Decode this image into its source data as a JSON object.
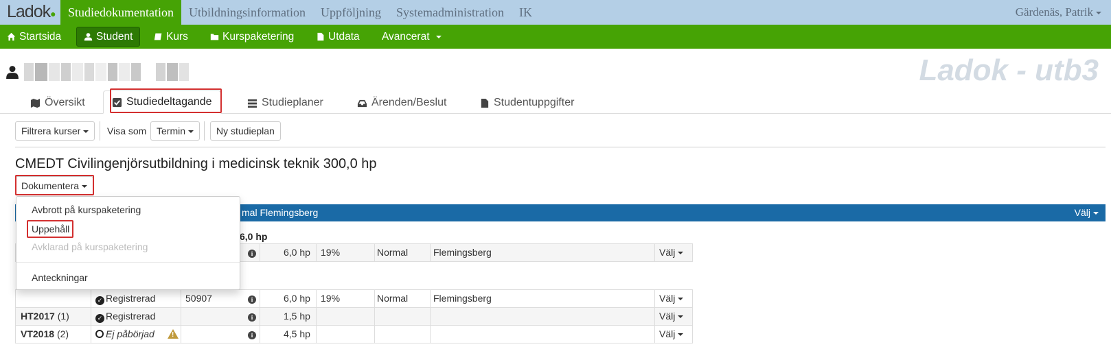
{
  "app": {
    "logo": "Ladok",
    "environment": "Ladok - utb3",
    "user": "Gärdenäs, Patrik"
  },
  "topnav": [
    {
      "label": "Studiedokumentation",
      "active": true
    },
    {
      "label": "Utbildningsinformation"
    },
    {
      "label": "Uppföljning"
    },
    {
      "label": "Systemadministration"
    },
    {
      "label": "IK"
    }
  ],
  "subnav": {
    "startsida": "Startsida",
    "student": "Student",
    "kurs": "Kurs",
    "kurspaketering": "Kurspaketering",
    "utdata": "Utdata",
    "avancerat": "Avancerat"
  },
  "tabs": {
    "oversikt": "Översikt",
    "studiedeltagande": "Studiedeltagande",
    "studieplaner": "Studieplaner",
    "arenden": "Ärenden/Beslut",
    "studentuppgifter": "Studentuppgifter"
  },
  "toolbar": {
    "filtrera": "Filtrera kurser",
    "visa_som": "Visa som",
    "termin": "Termin",
    "ny_studieplan": "Ny studieplan"
  },
  "program": {
    "title": "CMEDT Civilingenjörsutbildning i medicinsk teknik 300,0 hp",
    "dokumentera": "Dokumentera",
    "bluebar_text": "mal Flemingsberg",
    "bluebar_valj": "Välj",
    "partial_heading": "6,0 hp"
  },
  "dropdown": {
    "avbrott": "Avbrott på kurspaketering",
    "uppehall": "Uppehåll",
    "avklarad": "Avklarad på kurspaketering",
    "anteckningar": "Anteckningar"
  },
  "rows": [
    {
      "period": "",
      "count": "",
      "status": "",
      "code": "",
      "hp": "6,0 hp",
      "pct": "19%",
      "tempo": "Normal",
      "ort": "Flemingsberg",
      "valj": "Välj"
    },
    {
      "period": "",
      "count": "",
      "status": "Registrerad",
      "code": "50907",
      "hp": "6,0 hp",
      "pct": "19%",
      "tempo": "Normal",
      "ort": "Flemingsberg",
      "valj": "Välj"
    },
    {
      "period": "HT2017",
      "count": "(1)",
      "status": "Registrerad",
      "code": "",
      "hp": "1,5 hp",
      "pct": "",
      "tempo": "",
      "ort": "",
      "valj": "Välj"
    },
    {
      "period": "VT2018",
      "count": "(2)",
      "status": "Ej påbörjad",
      "code": "",
      "hp": "4,5 hp",
      "pct": "",
      "tempo": "",
      "ort": "",
      "valj": "Välj"
    }
  ]
}
